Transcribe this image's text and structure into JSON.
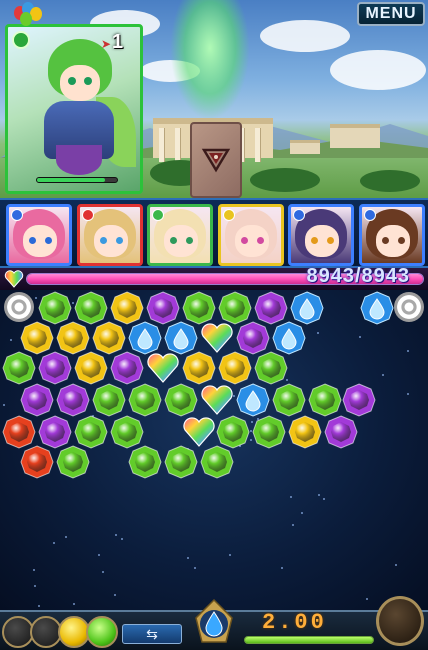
{
  "menu": {
    "label": "MENU"
  },
  "hero": {
    "turn_count": "1",
    "hp_fraction": 0.85
  },
  "enemy_card": {
    "icon": "triangle-sigil-icon"
  },
  "party": {
    "members": [
      {
        "hair": "#e96aa0",
        "eye": "#2a6ad8",
        "frame": "#3d7fff",
        "corner": "#2f6ae0"
      },
      {
        "hair": "#e4c27a",
        "eye": "#3a9ae0",
        "frame": "#e03232",
        "corner": "#e03232"
      },
      {
        "hair": "#f3e0b2",
        "eye": "#2e9a5c",
        "frame": "#3ab74a",
        "corner": "#3ab74a"
      },
      {
        "hair": "#f4d2c6",
        "eye": "#d24aa0",
        "frame": "#e9c420",
        "corner": "#e9c420"
      },
      {
        "hair": "#4a3a78",
        "eye": "#e49a1a",
        "frame": "#3d7fff",
        "corner": "#2f6ae0"
      },
      {
        "hair": "#6a3a22",
        "eye": "#6a3a22",
        "frame": "#3d7fff",
        "corner": "#2f6ae0"
      }
    ]
  },
  "hp": {
    "current": "8943",
    "max": "8943",
    "text": "8943/8943",
    "fraction": 1.0
  },
  "timer": {
    "value": "2.00",
    "fraction": 1.0
  },
  "board": {
    "colors": {
      "green": "#62cc2a",
      "yellow": "#f2c414",
      "purple": "#a23ad8",
      "blue": "#2a8ee6",
      "red": "#e6401e",
      "rainbow": "rainbow"
    },
    "orbs": [
      {
        "c": "green",
        "s": "gem"
      },
      {
        "c": "green",
        "s": "gem"
      },
      {
        "c": "yellow",
        "s": "gem"
      },
      {
        "c": "purple",
        "s": "gem"
      },
      {
        "c": "green",
        "s": "gem"
      },
      {
        "c": "green",
        "s": "gem"
      },
      {
        "c": "purple",
        "s": "gem"
      },
      {
        "c": "blue",
        "s": "drop"
      },
      {
        "c": "blue",
        "s": "drop"
      },
      {
        "c": "yellow",
        "s": "gem"
      },
      {
        "c": "yellow",
        "s": "gem"
      },
      {
        "c": "yellow",
        "s": "gem"
      },
      {
        "c": "blue",
        "s": "drop"
      },
      {
        "c": "blue",
        "s": "drop"
      },
      {
        "c": "rainbow",
        "s": "heart"
      },
      {
        "c": "purple",
        "s": "gem"
      },
      {
        "c": "blue",
        "s": "drop"
      },
      {
        "c": "green",
        "s": "gem"
      },
      {
        "c": "purple",
        "s": "gem"
      },
      {
        "c": "yellow",
        "s": "gem"
      },
      {
        "c": "purple",
        "s": "gem"
      },
      {
        "c": "rainbow",
        "s": "heart"
      },
      {
        "c": "yellow",
        "s": "gem"
      },
      {
        "c": "yellow",
        "s": "gem"
      },
      {
        "c": "green",
        "s": "gem"
      },
      {
        "c": "purple",
        "s": "gem"
      },
      {
        "c": "purple",
        "s": "gem"
      },
      {
        "c": "green",
        "s": "gem"
      },
      {
        "c": "green",
        "s": "gem"
      },
      {
        "c": "green",
        "s": "gem"
      },
      {
        "c": "rainbow",
        "s": "heart"
      },
      {
        "c": "blue",
        "s": "drop"
      },
      {
        "c": "green",
        "s": "gem"
      },
      {
        "c": "green",
        "s": "gem"
      },
      {
        "c": "purple",
        "s": "gem"
      },
      {
        "c": "red",
        "s": "gem"
      },
      {
        "c": "purple",
        "s": "gem"
      },
      {
        "c": "green",
        "s": "gem"
      },
      {
        "c": "green",
        "s": "gem"
      },
      {
        "c": "rainbow",
        "s": "heart"
      },
      {
        "c": "green",
        "s": "gem"
      },
      {
        "c": "green",
        "s": "gem"
      },
      {
        "c": "yellow",
        "s": "gem"
      },
      {
        "c": "purple",
        "s": "gem"
      },
      {
        "c": "red",
        "s": "gem"
      },
      {
        "c": "green",
        "s": "gem"
      },
      {
        "c": "green",
        "s": "gem"
      },
      {
        "c": "green",
        "s": "gem"
      },
      {
        "c": "green",
        "s": "gem"
      }
    ]
  },
  "bottom": {
    "slots": [
      "empty",
      "empty",
      "yellow",
      "green"
    ],
    "swap_icon": "swap-arrows-icon",
    "center_gem": "blue-drop-icon"
  }
}
